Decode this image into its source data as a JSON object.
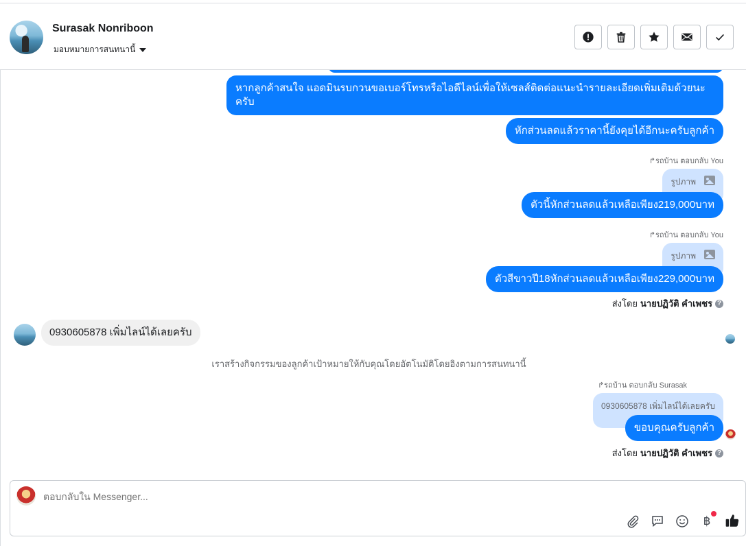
{
  "header": {
    "name": "Surasak Nonriboon",
    "assign_label": "มอบหมายการสนทนานี้",
    "actions": [
      "spam-report",
      "delete",
      "star",
      "mark-unread",
      "mark-done"
    ]
  },
  "messages": {
    "m1": "หากลูกค้าสนใจ แอดมินรบกวนขอเบอร์โทรหรือไอดีไลน์เพื่อให้เซลส์ติดต่อแนะนำรายละเอียดเพิ่มเติมด้วยนะ",
    "m1b": "ครับ",
    "m2": "หักส่วนลดแล้วราคานี้ยังคุยได้อีกนะครับลูกค้า",
    "reply1_tag": "รถบ้าน ตอบกลับ You",
    "reply1_preview": "รูปภาพ",
    "m3": "ตัวนี้หักส่วนลดแล้วเหลือเพียง219,000บาท",
    "reply2_tag": "รถบ้าน ตอบกลับ You",
    "reply2_preview": "รูปภาพ",
    "m4": "ตัวสีขาวปี18หักส่วนลดแล้วเหลือเพียง229,000บาท",
    "sent_by_label": "ส่งโดย",
    "sent_by_name": "นายปฏิวัติ คำเพชร",
    "incoming": "0930605878 เพิ่มไลน์ได้เลยครับ",
    "system_note": "เราสร้างกิจกรรมของลูกค้าเป้าหมายให้กับคุณโดยอัตโนมัติโดยอิงตามการสนทนานี้",
    "reply3_tag": "รถบ้าน ตอบกลับ Surasak",
    "reply3_preview": "0930605878 เพิ่มไลน์ได้เลยครับ",
    "m5": "ขอบคุณครับลูกค้า",
    "sent_by_label2": "ส่งโดย",
    "sent_by_name2": "นายปฏิวัติ คำเพชร"
  },
  "composer": {
    "placeholder": "ตอบกลับใน Messenger...",
    "tools": [
      "attachment-icon",
      "saved-replies-icon",
      "emoji-icon",
      "payment-icon",
      "like-icon"
    ]
  },
  "colors": {
    "outgoing_bubble": "#0a7cff",
    "incoming_bubble": "#f0f0f0",
    "reply_preview": "#cfe3ff",
    "notification_dot": "#f02849"
  }
}
